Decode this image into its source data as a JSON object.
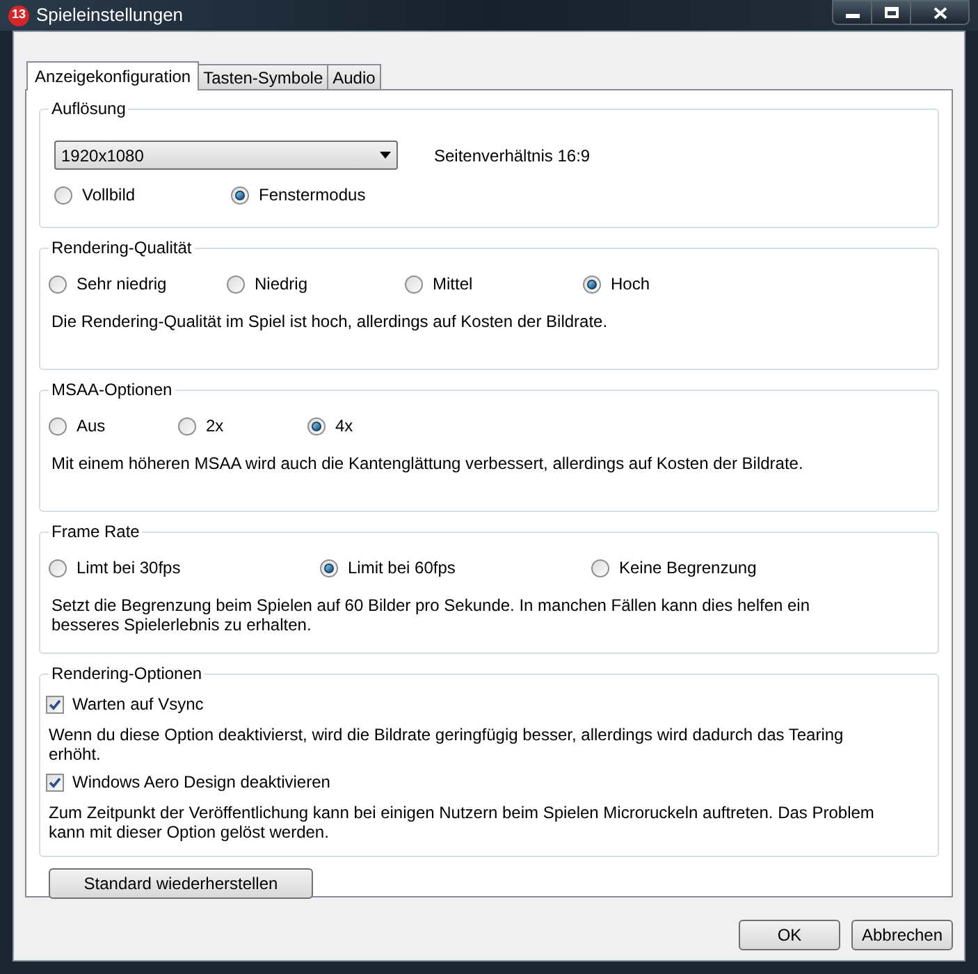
{
  "window": {
    "title": "Spieleinstellungen",
    "app_badge": "13"
  },
  "tabs": [
    {
      "label": "Anzeigekonfiguration",
      "selected": true
    },
    {
      "label": "Tasten-Symbole",
      "selected": false
    },
    {
      "label": "Audio",
      "selected": false
    }
  ],
  "groups": [
    {
      "kind": "resolution",
      "title": "Auflösung",
      "dropdown": {
        "value": "1920x1080"
      },
      "aspect": "Seitenverhältnis 16:9",
      "options": [
        {
          "label": "Vollbild",
          "selected": false
        },
        {
          "label": "Fenstermodus",
          "selected": true
        }
      ]
    },
    {
      "kind": "radios",
      "title": "Rendering-Qualität",
      "options": [
        {
          "label": "Sehr niedrig",
          "selected": false
        },
        {
          "label": "Niedrig",
          "selected": false
        },
        {
          "label": "Mittel",
          "selected": false
        },
        {
          "label": "Hoch",
          "selected": true
        }
      ],
      "description": "Die Rendering-Qualität im Spiel ist hoch, allerdings auf Kosten der Bildrate."
    },
    {
      "kind": "radios",
      "title": "MSAA-Optionen",
      "options": [
        {
          "label": "Aus",
          "selected": false
        },
        {
          "label": "2x",
          "selected": false
        },
        {
          "label": "4x",
          "selected": true
        }
      ],
      "description": "Mit einem höheren MSAA wird auch die Kantenglättung verbessert, allerdings auf Kosten der Bildrate."
    },
    {
      "kind": "radios",
      "title": "Frame Rate",
      "options": [
        {
          "label": "Limt bei 30fps",
          "selected": false
        },
        {
          "label": "Limit bei 60fps",
          "selected": true
        },
        {
          "label": "Keine Begrenzung",
          "selected": false
        }
      ],
      "description": "Setzt die Begrenzung beim Spielen auf 60 Bilder pro Sekunde. In manchen Fällen kann dies helfen ein besseres Spielerlebnis zu erhalten."
    },
    {
      "kind": "checks",
      "title": "Rendering-Optionen",
      "items": [
        {
          "label": "Warten auf Vsync",
          "checked": true,
          "description": "Wenn du diese Option deaktivierst, wird die Bildrate geringfügig besser, allerdings wird dadurch das Tearing erhöht."
        },
        {
          "label": "Windows Aero Design deaktivieren",
          "checked": true,
          "description": "Zum Zeitpunkt der Veröffentlichung kann bei einigen Nutzern beim Spielen Microruckeln auftreten. Das Problem kann mit dieser Option gelöst werden."
        }
      ]
    }
  ],
  "reset_button": "Standard wiederherstellen",
  "buttons": [
    "OK",
    "Abbrechen"
  ]
}
